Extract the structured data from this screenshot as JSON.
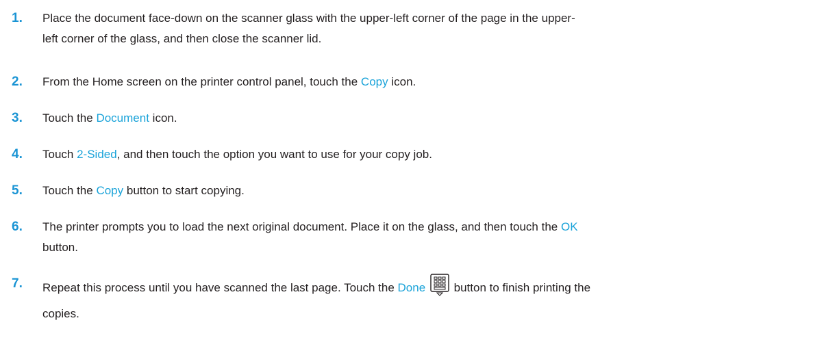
{
  "colors": {
    "step_number": "#1a94d4",
    "link": "#1aa3d9",
    "body_text": "#231f20"
  },
  "steps": [
    {
      "number": "1.",
      "text_a": "Place the document face-down on the scanner glass with the upper-left corner of the page in the upper-",
      "text_b": "left corner of the glass, and then close the scanner lid."
    },
    {
      "number": "2.",
      "pre": "From the Home screen on the printer control panel, touch the ",
      "link": "Copy",
      "post": " icon."
    },
    {
      "number": "3.",
      "pre": "Touch the ",
      "link": "Document",
      "post": " icon."
    },
    {
      "number": "4.",
      "pre": "Touch ",
      "link": "2-Sided",
      "post": ", and then touch the option you want to use for your copy job."
    },
    {
      "number": "5.",
      "pre": "Touch the ",
      "link": "Copy",
      "post": " button to start copying."
    },
    {
      "number": "6.",
      "pre": "The printer prompts you to load the next original document. Place it on the glass, and then touch the ",
      "link": "OK",
      "post": "",
      "line2": "button."
    },
    {
      "number": "7.",
      "pre": "Repeat this process until you have scanned the last page. Touch the ",
      "link": "Done",
      "icon": "done-grid-icon",
      "post": "button to finish printing the",
      "line2": "copies."
    }
  ]
}
